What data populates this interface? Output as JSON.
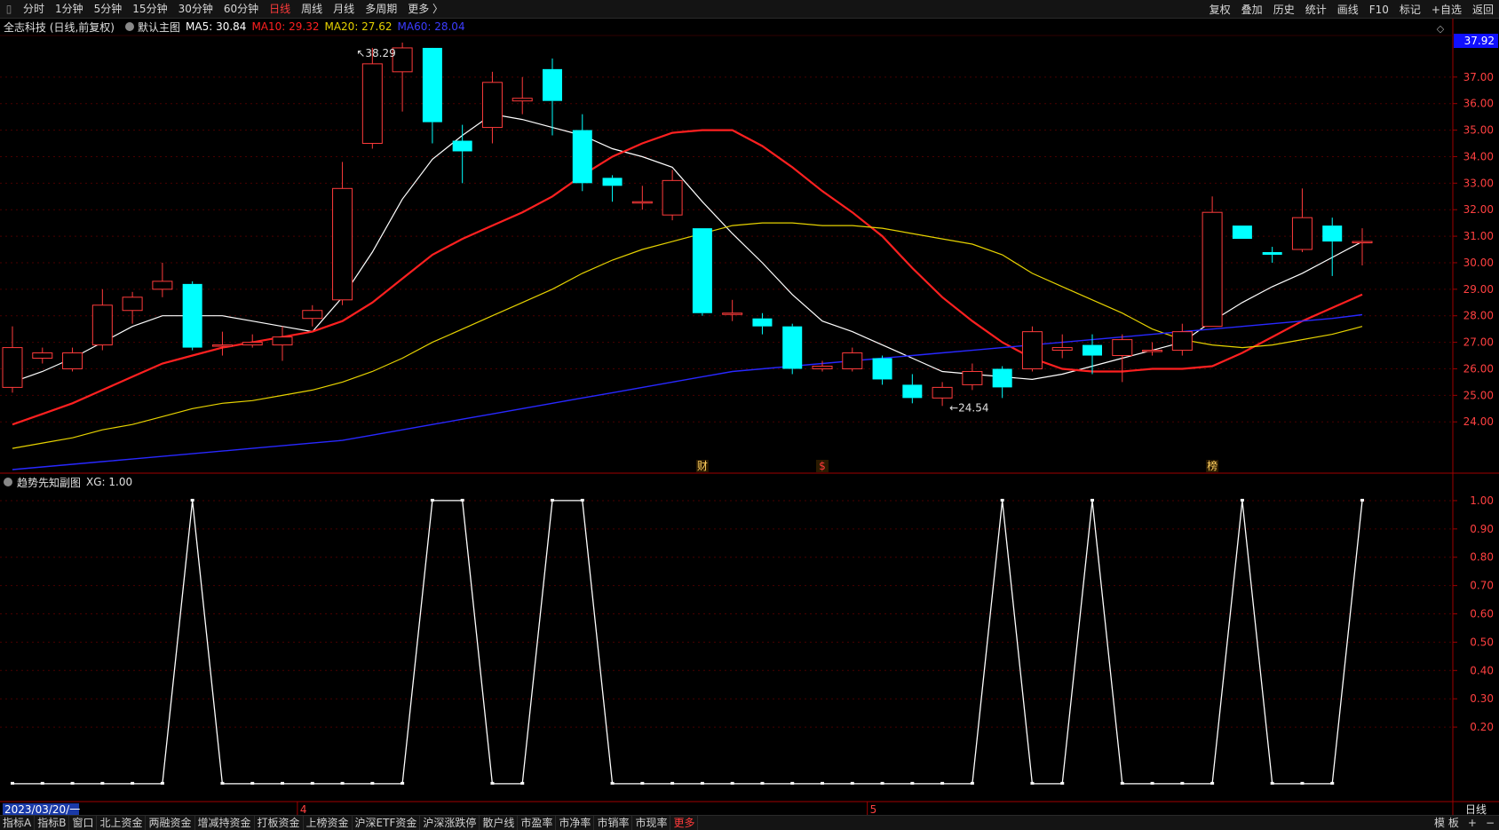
{
  "toolbar": {
    "periods": [
      "分时",
      "1分钟",
      "5分钟",
      "15分钟",
      "30分钟",
      "60分钟",
      "日线",
      "周线",
      "月线",
      "多周期",
      "更多 〉"
    ],
    "active_period": "日线",
    "right_items": [
      "复权",
      "叠加",
      "历史",
      "统计",
      "画线",
      "F10",
      "标记",
      "+自选",
      "返回"
    ]
  },
  "main_info": {
    "stock_label": "全志科技 (日线,前复权)",
    "template": "默认主图",
    "ma5": "MA5: 30.84",
    "ma10": "MA10: 29.32",
    "ma20": "MA20: 27.62",
    "ma60": "MA60: 28.04"
  },
  "sub_info": {
    "title": "趋势先知副图",
    "xg": "XG: 1.00"
  },
  "bottombar": {
    "items": [
      "指标A",
      "指标B",
      "窗口",
      "北上资金",
      "两融资金",
      "增减持资金",
      "打板资金",
      "上榜资金",
      "沪深ETF资金",
      "沪深涨跌停",
      "散户线",
      "市盈率",
      "市净率",
      "市销率",
      "市现率",
      "更多"
    ],
    "active_item": "更多",
    "right_items": [
      "模 板",
      "+",
      "−"
    ]
  },
  "colors": {
    "up": "#ff3b3b",
    "down": "#00ffff",
    "ma5": "#ffffff",
    "ma10": "#ff2020",
    "ma20": "#e6d200",
    "ma60": "#2828ff",
    "grid": "#4a0000",
    "border": "#a00000",
    "axis_text": "#ff4040",
    "signal": "#ffffff"
  },
  "chart_data": [
    {
      "type": "candlestick",
      "title": "全志科技 (日线,前复权)",
      "y_ticks": [
        24.0,
        25.0,
        26.0,
        27.0,
        28.0,
        29.0,
        30.0,
        31.0,
        32.0,
        33.0,
        34.0,
        35.0,
        36.0,
        37.0
      ],
      "y_tick_labels": [
        "24.00",
        "25.00",
        "26.00",
        "27.00",
        "28.00",
        "29.00",
        "30.00",
        "31.00",
        "32.00",
        "33.00",
        "34.00",
        "35.00",
        "36.00",
        "37.00"
      ],
      "ylim": [
        22.1,
        38.5
      ],
      "current_price_label": "37.92",
      "high_annotation": {
        "label": "38.29",
        "index": 12
      },
      "low_annotation": {
        "label": "←24.54",
        "index": 31
      },
      "event_markers": [
        {
          "label": "财",
          "index": 23
        },
        {
          "label": "$",
          "index": 27
        },
        {
          "label": "榜",
          "index": 40
        }
      ],
      "date_label": "2023/03/20/一",
      "month_labels": [
        {
          "label": "4",
          "index": 10
        },
        {
          "label": "5",
          "index": 29
        }
      ],
      "period_label": "日线",
      "candles": [
        [
          25.3,
          26.8,
          27.6,
          25.1
        ],
        [
          26.4,
          26.6,
          26.8,
          26.2
        ],
        [
          26.0,
          26.6,
          26.8,
          25.9
        ],
        [
          26.9,
          28.4,
          29.0,
          26.7
        ],
        [
          28.2,
          28.7,
          28.9,
          27.7
        ],
        [
          29.0,
          29.3,
          30.0,
          28.7
        ],
        [
          29.2,
          26.8,
          29.3,
          26.7
        ],
        [
          26.9,
          26.9,
          27.4,
          26.5
        ],
        [
          26.9,
          27.0,
          27.3,
          26.8
        ],
        [
          26.9,
          27.2,
          27.6,
          26.3
        ],
        [
          27.9,
          28.2,
          28.4,
          27.6
        ],
        [
          28.6,
          32.8,
          33.8,
          28.4
        ],
        [
          34.5,
          37.5,
          38.1,
          34.3
        ],
        [
          37.2,
          38.1,
          38.3,
          35.7
        ],
        [
          38.1,
          35.3,
          38.0,
          34.5
        ],
        [
          34.6,
          34.2,
          35.2,
          33.0
        ],
        [
          35.1,
          36.8,
          37.2,
          34.5
        ],
        [
          36.1,
          36.2,
          37.0,
          35.6
        ],
        [
          37.3,
          36.1,
          37.7,
          34.8
        ],
        [
          35.0,
          33.0,
          35.6,
          32.7
        ],
        [
          33.2,
          32.9,
          33.3,
          32.3
        ],
        [
          32.3,
          32.3,
          32.9,
          32.0
        ],
        [
          31.8,
          33.1,
          33.5,
          31.6
        ],
        [
          31.3,
          28.1,
          31.3,
          28.0
        ],
        [
          28.1,
          28.1,
          28.6,
          27.8
        ],
        [
          27.9,
          27.6,
          28.1,
          27.3
        ],
        [
          27.6,
          26.0,
          27.7,
          25.8
        ],
        [
          26.0,
          26.1,
          26.3,
          25.9
        ],
        [
          26.0,
          26.6,
          26.8,
          25.9
        ],
        [
          26.4,
          25.6,
          26.5,
          25.4
        ],
        [
          25.4,
          24.9,
          25.8,
          24.7
        ],
        [
          24.9,
          25.3,
          25.5,
          24.6
        ],
        [
          25.4,
          25.9,
          26.2,
          25.2
        ],
        [
          26.0,
          25.3,
          26.1,
          24.9
        ],
        [
          26.0,
          27.4,
          27.6,
          25.9
        ],
        [
          26.7,
          26.8,
          27.3,
          26.4
        ],
        [
          26.9,
          26.5,
          27.3,
          25.8
        ],
        [
          26.5,
          27.1,
          27.3,
          25.5
        ],
        [
          26.7,
          26.7,
          27.0,
          26.5
        ],
        [
          26.7,
          27.4,
          27.7,
          26.5
        ],
        [
          27.6,
          31.9,
          32.5,
          27.6
        ],
        [
          31.4,
          30.9,
          31.4,
          30.9
        ],
        [
          30.4,
          30.3,
          30.6,
          30.0
        ],
        [
          30.5,
          31.7,
          32.8,
          30.4
        ],
        [
          31.4,
          30.8,
          31.7,
          29.5
        ],
        [
          30.8,
          30.8,
          31.3,
          29.9
        ]
      ],
      "series": [
        {
          "name": "MA5",
          "values": [
            25.5,
            25.9,
            26.4,
            27.0,
            27.6,
            28.0,
            28.0,
            28.0,
            27.8,
            27.6,
            27.4,
            28.7,
            30.4,
            32.4,
            33.9,
            34.8,
            35.6,
            35.4,
            35.1,
            34.8,
            34.3,
            34.0,
            33.6,
            32.3,
            31.1,
            30.0,
            28.8,
            27.8,
            27.4,
            26.9,
            26.4,
            25.9,
            25.8,
            25.7,
            25.6,
            25.8,
            26.1,
            26.4,
            26.7,
            27.0,
            27.8,
            28.5,
            29.1,
            29.6,
            30.2,
            30.8
          ]
        },
        {
          "name": "MA10",
          "values": [
            23.9,
            24.3,
            24.7,
            25.2,
            25.7,
            26.2,
            26.5,
            26.8,
            27.0,
            27.2,
            27.4,
            27.8,
            28.5,
            29.4,
            30.3,
            30.9,
            31.4,
            31.9,
            32.5,
            33.3,
            34.0,
            34.5,
            34.9,
            35.0,
            35.0,
            34.4,
            33.6,
            32.7,
            31.9,
            31.0,
            29.8,
            28.7,
            27.8,
            27.0,
            26.4,
            26.0,
            25.9,
            25.9,
            26.0,
            26.0,
            26.1,
            26.6,
            27.2,
            27.8,
            28.3,
            28.8
          ]
        },
        {
          "name": "MA20",
          "values": [
            23.0,
            23.2,
            23.4,
            23.7,
            23.9,
            24.2,
            24.5,
            24.7,
            24.8,
            25.0,
            25.2,
            25.5,
            25.9,
            26.4,
            27.0,
            27.5,
            28.0,
            28.5,
            29.0,
            29.6,
            30.1,
            30.5,
            30.8,
            31.1,
            31.4,
            31.5,
            31.5,
            31.4,
            31.4,
            31.3,
            31.1,
            30.9,
            30.7,
            30.3,
            29.6,
            29.1,
            28.6,
            28.1,
            27.5,
            27.1,
            26.9,
            26.8,
            26.9,
            27.1,
            27.3,
            27.6
          ]
        },
        {
          "name": "MA60",
          "values": [
            22.2,
            22.3,
            22.4,
            22.5,
            22.6,
            22.7,
            22.8,
            22.9,
            23.0,
            23.1,
            23.2,
            23.3,
            23.5,
            23.7,
            23.9,
            24.1,
            24.3,
            24.5,
            24.7,
            24.9,
            25.1,
            25.3,
            25.5,
            25.7,
            25.9,
            26.0,
            26.1,
            26.2,
            26.3,
            26.4,
            26.5,
            26.6,
            26.7,
            26.8,
            26.9,
            27.0,
            27.1,
            27.2,
            27.3,
            27.4,
            27.5,
            27.6,
            27.7,
            27.8,
            27.9,
            28.04
          ]
        }
      ]
    },
    {
      "type": "line",
      "title": "趋势先知副图",
      "y_ticks": [
        0.2,
        0.3,
        0.4,
        0.5,
        0.6,
        0.7,
        0.8,
        0.9,
        1.0
      ],
      "y_tick_labels": [
        "0.20",
        "0.30",
        "0.40",
        "0.50",
        "0.60",
        "0.70",
        "0.80",
        "0.90",
        "1.00"
      ],
      "ylim": [
        -0.06,
        1.05
      ],
      "series": [
        {
          "name": "XG",
          "values": [
            0,
            0,
            0,
            0,
            0,
            0,
            1,
            0,
            0,
            0,
            0,
            0,
            0,
            0,
            1,
            1,
            0,
            0,
            1,
            1,
            0,
            0,
            0,
            0,
            0,
            0,
            0,
            0,
            0,
            0,
            0,
            0,
            0,
            1,
            0,
            0,
            1,
            0,
            0,
            0,
            0,
            1,
            0,
            0,
            0,
            1
          ]
        }
      ]
    }
  ]
}
